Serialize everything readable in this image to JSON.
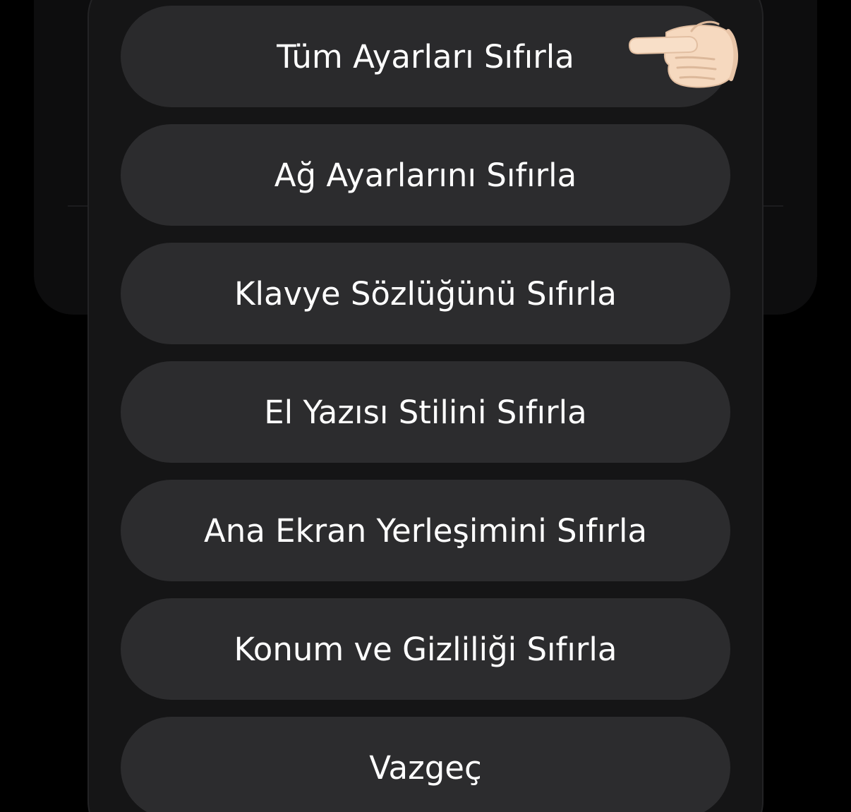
{
  "reset_sheet": {
    "actions": [
      {
        "label": "Tüm Ayarları Sıfırla"
      },
      {
        "label": "Ağ Ayarlarını Sıfırla"
      },
      {
        "label": "Klavye Sözlüğünü Sıfırla"
      },
      {
        "label": "El Yazısı Stilini Sıfırla"
      },
      {
        "label": "Ana Ekran Yerleşimini Sıfırla"
      },
      {
        "label": "Konum ve Gizliliği Sıfırla"
      }
    ],
    "cancel_label": "Vazgeç",
    "pointer_icon": "backhand-index-pointing-left-emoji"
  },
  "colors": {
    "background": "#000000",
    "sheet": "#151516",
    "button": "#2c2c2e",
    "text": "#ffffff",
    "skin": "#f6d9bf"
  }
}
